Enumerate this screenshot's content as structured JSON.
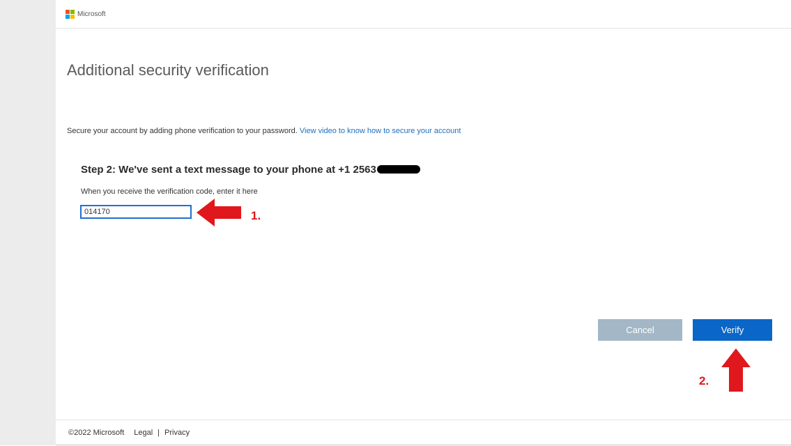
{
  "header": {
    "logo_text": "Microsoft",
    "logo_colors": [
      "#f25022",
      "#7fba00",
      "#00a4ef",
      "#ffb900"
    ]
  },
  "main": {
    "title": "Additional security verification",
    "intro_text": "Secure your account by adding phone verification to your password.",
    "intro_link": "View video to know how to secure your account",
    "step_heading": "Step 2: We've sent a text message to your phone at +1 2563",
    "code_label": "When you receive the verification code, enter it here",
    "code_value": "014170"
  },
  "annotations": {
    "step1_label": "1.",
    "step2_label": "2.",
    "arrow_color": "#e0171c"
  },
  "actions": {
    "cancel_label": "Cancel",
    "verify_label": "Verify"
  },
  "footer": {
    "copyright": "©2022 Microsoft",
    "legal_label": "Legal",
    "separator": "|",
    "privacy_label": "Privacy"
  },
  "colors": {
    "primary": "#0a66c7",
    "cancel_bg": "#a3b7c7",
    "link": "#1f6fbd"
  }
}
